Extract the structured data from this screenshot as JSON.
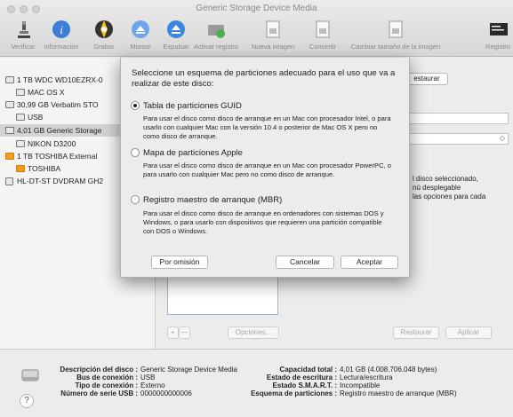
{
  "window": {
    "title": "Generic Storage Device Media"
  },
  "toolbar": {
    "items": [
      {
        "label": "Verificar",
        "icon": "microscope-icon"
      },
      {
        "label": "Información",
        "icon": "info-icon"
      },
      {
        "label": "Grabar",
        "icon": "burn-icon"
      },
      {
        "label": "Montar",
        "icon": "mount-icon"
      },
      {
        "label": "Expulsar",
        "icon": "eject-icon"
      },
      {
        "label": "Activar registro",
        "icon": "log-icon"
      },
      {
        "label": "Nueva imagen",
        "icon": "new-image-icon"
      },
      {
        "label": "Convertir",
        "icon": "convert-icon"
      },
      {
        "label": "Cambiar tamaño de la imagen",
        "icon": "resize-image-icon"
      },
      {
        "label": "Registro",
        "icon": "console-log-icon"
      }
    ]
  },
  "sidebar": {
    "items": [
      {
        "label": "1 TB WDC WD10EZRX-0"
      },
      {
        "label": "MAC OS X"
      },
      {
        "label": "30,99 GB Verbatim STO"
      },
      {
        "label": "USB"
      },
      {
        "label": "4,01 GB Generic Storage"
      },
      {
        "label": "NIKON D3200"
      },
      {
        "label": "1 TB TOSHIBA External"
      },
      {
        "label": "TOSHIBA"
      },
      {
        "label": "HL-DT-ST DVDRAM GH2"
      }
    ]
  },
  "main": {
    "restore_top": "estaurar",
    "hint_lines": [
      "l disco seleccionado,",
      "nú desplegable",
      "las opciones para cada"
    ],
    "plus": "+",
    "minus": "—",
    "options": "Opciones...",
    "restore": "Restaurar",
    "apply": "Aplicar"
  },
  "sheet": {
    "prompt": "Seleccione un esquema de particiones adecuado para el uso que va a realizar de este disco:",
    "options": [
      {
        "label": "Tabla de particiones GUID",
        "checked": true,
        "description": "Para usar el disco como disco de arranque en un Mac con procesador Intel, o para usarlo con cualquier Mac con la versión 10.4 o posterior de Mac OS X pero no como disco de arranque."
      },
      {
        "label": "Mapa de particiones Apple",
        "checked": false,
        "description": "Para usar el disco como disco de arranque en un Mac con procesador PowerPC, o para usarlo con cualquier Mac pero no como disco de arranque."
      },
      {
        "label": "Registro maestro de arranque (MBR)",
        "checked": false,
        "description": "Para usar el disco como disco de arranque en ordenadores con sistemas DOS y Windows, o para usarlo con dispositivos que requieren una partición compatible con DOS o Windows."
      }
    ],
    "default_button": "Por omisión",
    "cancel_button": "Cancelar",
    "accept_button": "Aceptar"
  },
  "info": {
    "left": [
      {
        "key": "Descripción del disco :",
        "value": "Generic Storage Device Media"
      },
      {
        "key": "Bus de conexión :",
        "value": "USB"
      },
      {
        "key": "Tipo de conexión :",
        "value": "Externo"
      },
      {
        "key": "Número de serie USB :",
        "value": "0000000000006"
      }
    ],
    "right": [
      {
        "key": "Capacidad total :",
        "value": "4,01 GB (4.008.706.048 bytes)"
      },
      {
        "key": "Estado de escritura :",
        "value": "Lectura/escritura"
      },
      {
        "key": "Estado S.M.A.R.T. :",
        "value": "Incompatible"
      },
      {
        "key": "Esquema de particiones :",
        "value": "Registro maestro de arranque (MBR)"
      }
    ]
  },
  "help": "?"
}
